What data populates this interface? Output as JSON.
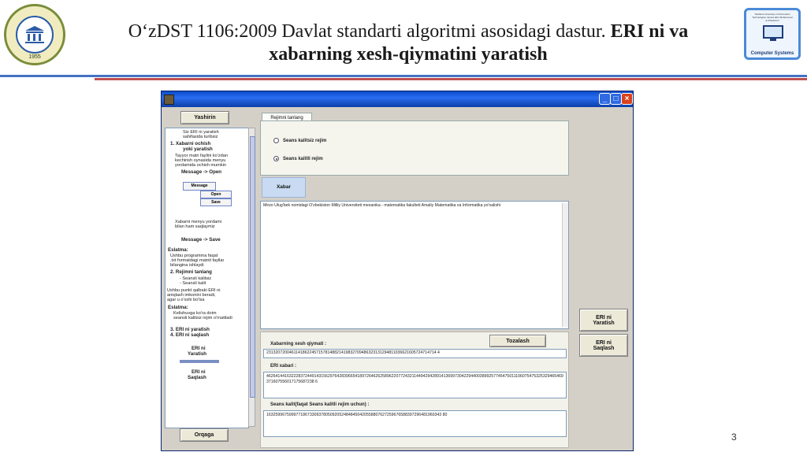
{
  "slide": {
    "title_regular": "O‘zDST 1106:2009 Davlat standarti algoritmi asosidagi dastur. ",
    "title_bold_1": "ERI ni va",
    "title_bold_2": "xabarning xesh-qiymatini yaratish",
    "left_logo_year": "1955",
    "right_logo_caption": "Computer Systems",
    "right_logo_text": "Tashkent University of Information Technologies named after Muhammad al-Khwarizmi",
    "page_number": "3"
  },
  "app": {
    "left_panel": {
      "top_button": "Yashirin",
      "bottom_button": "Orqaga",
      "lines": [
        "Siz ERI ni yaratish",
        "sahifasida turibsiz",
        "1. Xabarni ochish",
        "yoki yaratish",
        "Tayyor matn faylini ko'zdan",
        "kechirish oynasida menyu",
        "yordamida ochish mumkin",
        "Message -> Open",
        "Xabarni menyu yordami",
        "bilan ham saqlaymiz",
        "Message -> Save",
        "Eslatma:",
        "Ushbu programma faqat",
        ".txt formatdagi matnli fayllar",
        "bilangina ishlaydi",
        "2. Rejimni tanlang",
        "- Seansli kalitsiz",
        "- Seansli kalit",
        "Ushbu punkt qalbaki ERI ni",
        "aniqlash imkonini beradi,",
        "agar u o'xshi bo'lsa",
        "Eslatma:",
        "Kelishuvga ko'ra doim",
        "seansli kalitsiz rejim o'rnatiladi",
        "3. ERI ni yaratish",
        "4. ERI ni saqlash",
        "ERI ni",
        "Yaratish",
        "ERI ni",
        "Saqlash"
      ],
      "menu_example": [
        "Message",
        "Open",
        "Save"
      ]
    },
    "mode_tab": "Rejimni tanlang",
    "radio_options": [
      {
        "label": "Seans kalitsiz rejim",
        "selected": false
      },
      {
        "label": "Seans kalitli rejim",
        "selected": true
      }
    ],
    "message_header": "Xabar",
    "message_text": "Mirzo Ulug'bek nomidagi O'zbekiston Milliy Universiteti mexanika - matematika fakulteti Amaliy Matematika va Informatika yo'nalishi",
    "clear_button": "Tozalash",
    "hash_label": "Xabarning xesh qiymati :",
    "hash_value": "231320720046114186224571578148821419832709486323131294811036621605724714714 4",
    "eri_label": "ERI xabari :",
    "eri_value": "46264144163222837244914315629764283966541897264626258962207724321144942942891413699730422944003899257745475011106075475325329465469371607556017175687238 6",
    "session_label": "Seans kalit(faqat Seans kalitli rejim uchun) :",
    "session_value": "16325996759997718673309378050920524848450420558807627259676588397296481960343 80",
    "side_buttons": [
      {
        "line1": "ERI ni",
        "line2": "Yaratish"
      },
      {
        "line1": "ERI ni",
        "line2": "Saqlash"
      }
    ],
    "colors": {
      "titlebar": "#0a4bc8",
      "window_bg": "#d4d0c8",
      "close": "#d9421c"
    }
  }
}
